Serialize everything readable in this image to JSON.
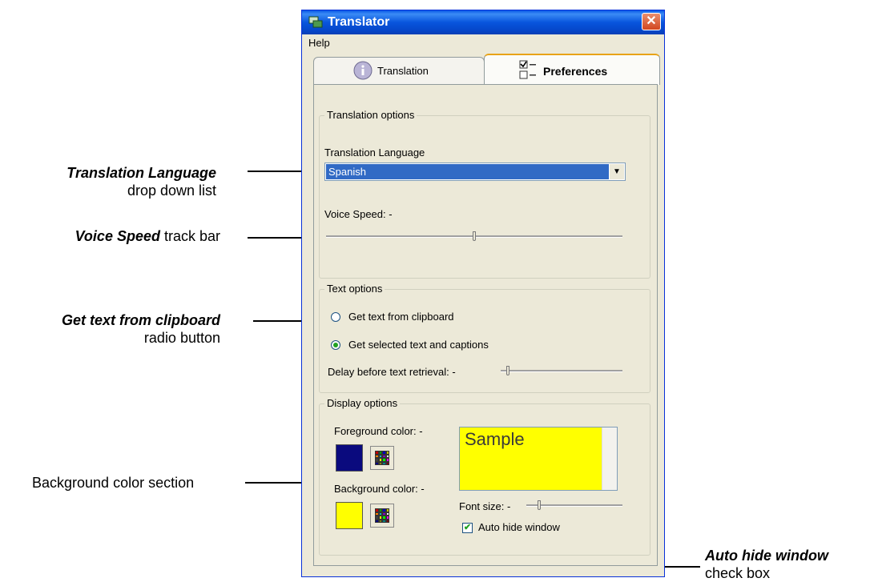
{
  "window": {
    "title": "Translator",
    "close_glyph": "✕"
  },
  "menu": {
    "help": "Help"
  },
  "tabs": [
    {
      "label": "Translation",
      "icon": "info-icon",
      "selected": false
    },
    {
      "label": "Preferences",
      "icon": "preferences-icon",
      "selected": true
    }
  ],
  "translation_options": {
    "legend": "Translation options",
    "language_label": "Translation Language",
    "language_value": "Spanish",
    "voice_speed_label": "Voice Speed: -",
    "voice_speed_level": 0.5
  },
  "text_options": {
    "legend": "Text options",
    "radio_clipboard": "Get text from clipboard",
    "radio_selected": "Get selected text and captions",
    "selected_option": "selected",
    "delay_label": "Delay before text retrieval: -",
    "delay_level": 0.05
  },
  "display_options": {
    "legend": "Display options",
    "foreground_label": "Foreground color: -",
    "background_label": "Background color: -",
    "foreground_color": "#0a0a7e",
    "background_color": "#ffff00",
    "sample_text": "Sample",
    "font_size_label": "Font size: -",
    "font_size_level": 0.12,
    "auto_hide_label": "Auto hide window",
    "auto_hide_checked": true
  },
  "callouts": {
    "translation_language_bold": "Translation Language",
    "translation_language_rest": "drop down list",
    "voice_speed_bold": "Voice Speed",
    "voice_speed_rest": " track bar",
    "clipboard_bold": "Get text from clipboard",
    "clipboard_rest": "radio button",
    "background_color": "Background color section",
    "auto_hide_bold": "Auto hide window",
    "auto_hide_rest": "check box"
  }
}
